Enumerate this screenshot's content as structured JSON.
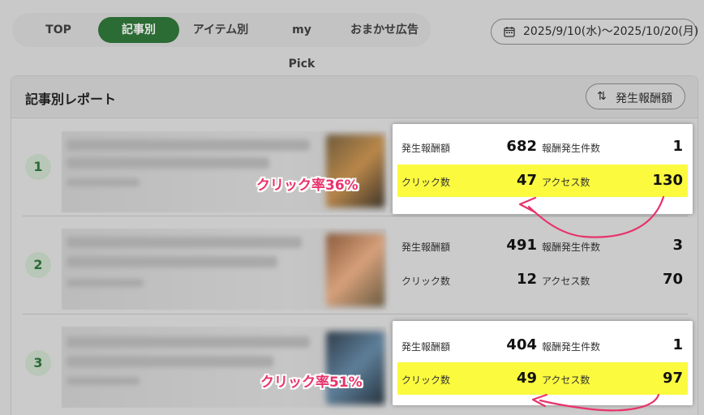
{
  "nav": {
    "tabs": [
      {
        "label": "TOP"
      },
      {
        "label": "記事別"
      },
      {
        "label": "アイテム別"
      },
      {
        "label": "my Pick"
      },
      {
        "label": "おまかせ広告"
      }
    ],
    "active_tab": "記事別",
    "date_range": "2025/9/10(水)〜2025/10/20(月)",
    "date_icon": "calendar-icon"
  },
  "report": {
    "title": "記事別レポート",
    "sort_label": "発生報酬額",
    "sort_icon": "sort-arrows-icon",
    "labels": {
      "reward": "発生報酬額",
      "reward_count": "報酬発生件数",
      "clicks": "クリック数",
      "access": "アクセス数"
    },
    "rows": [
      {
        "rank": "1",
        "reward": "682",
        "reward_count": "1",
        "clicks": "47",
        "access": "130",
        "annotation": "クリック率36%"
      },
      {
        "rank": "2",
        "reward": "491",
        "reward_count": "3",
        "clicks": "12",
        "access": "70",
        "annotation": ""
      },
      {
        "rank": "3",
        "reward": "404",
        "reward_count": "1",
        "clicks": "49",
        "access": "97",
        "annotation": "クリック率51%"
      }
    ]
  },
  "colors": {
    "accent": "#2b6b34",
    "highlight": "#fbfa3f",
    "annotation": "#e8336b"
  }
}
